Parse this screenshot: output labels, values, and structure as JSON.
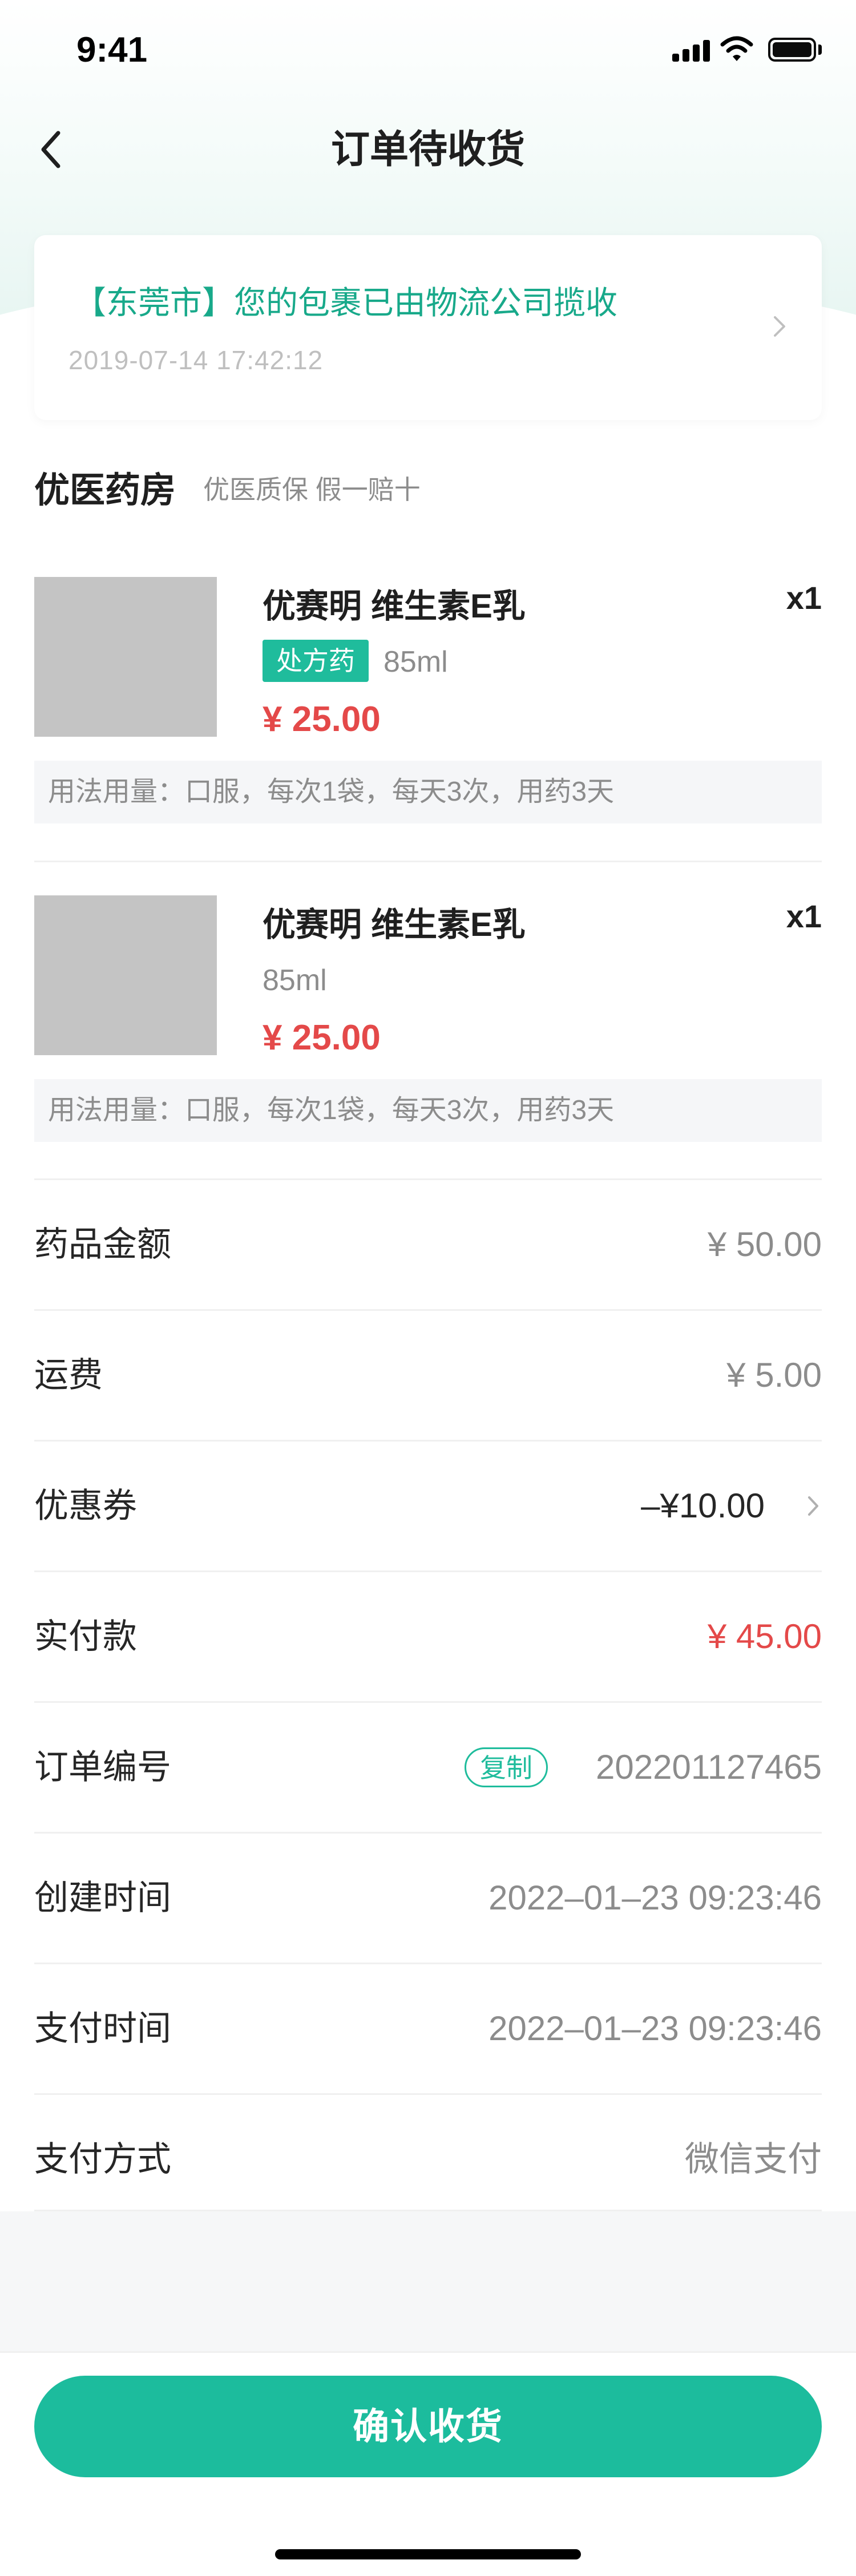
{
  "status_bar": {
    "time": "9:41"
  },
  "nav": {
    "title": "订单待收货"
  },
  "logistics": {
    "message": "【东莞市】您的包裹已由物流公司揽收",
    "time": "2019-07-14  17:42:12"
  },
  "shop": {
    "name": "优医药房",
    "tag": "优医质保 假一赔十"
  },
  "products": [
    {
      "name": "优赛明 维生素E乳",
      "qty": "x1",
      "badge": "处方药",
      "spec": "85ml",
      "price": "¥ 25.00",
      "usage": "用法用量：口服，每次1袋，每天3次，用药3天"
    },
    {
      "name": "优赛明 维生素E乳",
      "qty": "x1",
      "spec": "85ml",
      "price": "¥ 25.00",
      "usage": "用法用量：口服，每次1袋，每天3次，用药3天"
    }
  ],
  "summary": {
    "drug_amount": {
      "label": "药品金额",
      "value": "¥ 50.00"
    },
    "shipping": {
      "label": "运费",
      "value": "¥ 5.00"
    },
    "coupon": {
      "label": "优惠券",
      "value": "–¥10.00"
    },
    "paid": {
      "label": "实付款",
      "value": "¥ 45.00"
    },
    "order_no": {
      "label": "订单编号",
      "copy_label": "复制",
      "value": "202201127465"
    },
    "created": {
      "label": "创建时间",
      "value": "2022–01–23 09:23:46"
    },
    "paid_time": {
      "label": "支付时间",
      "value": "2022–01–23 09:23:46"
    },
    "pay_method": {
      "label": "支付方式",
      "value": "微信支付"
    }
  },
  "confirm_button": {
    "label": "确认收货"
  },
  "colors": {
    "accent": "#1cbc9d",
    "price": "#e44949",
    "logistics_text": "#18a98a"
  }
}
